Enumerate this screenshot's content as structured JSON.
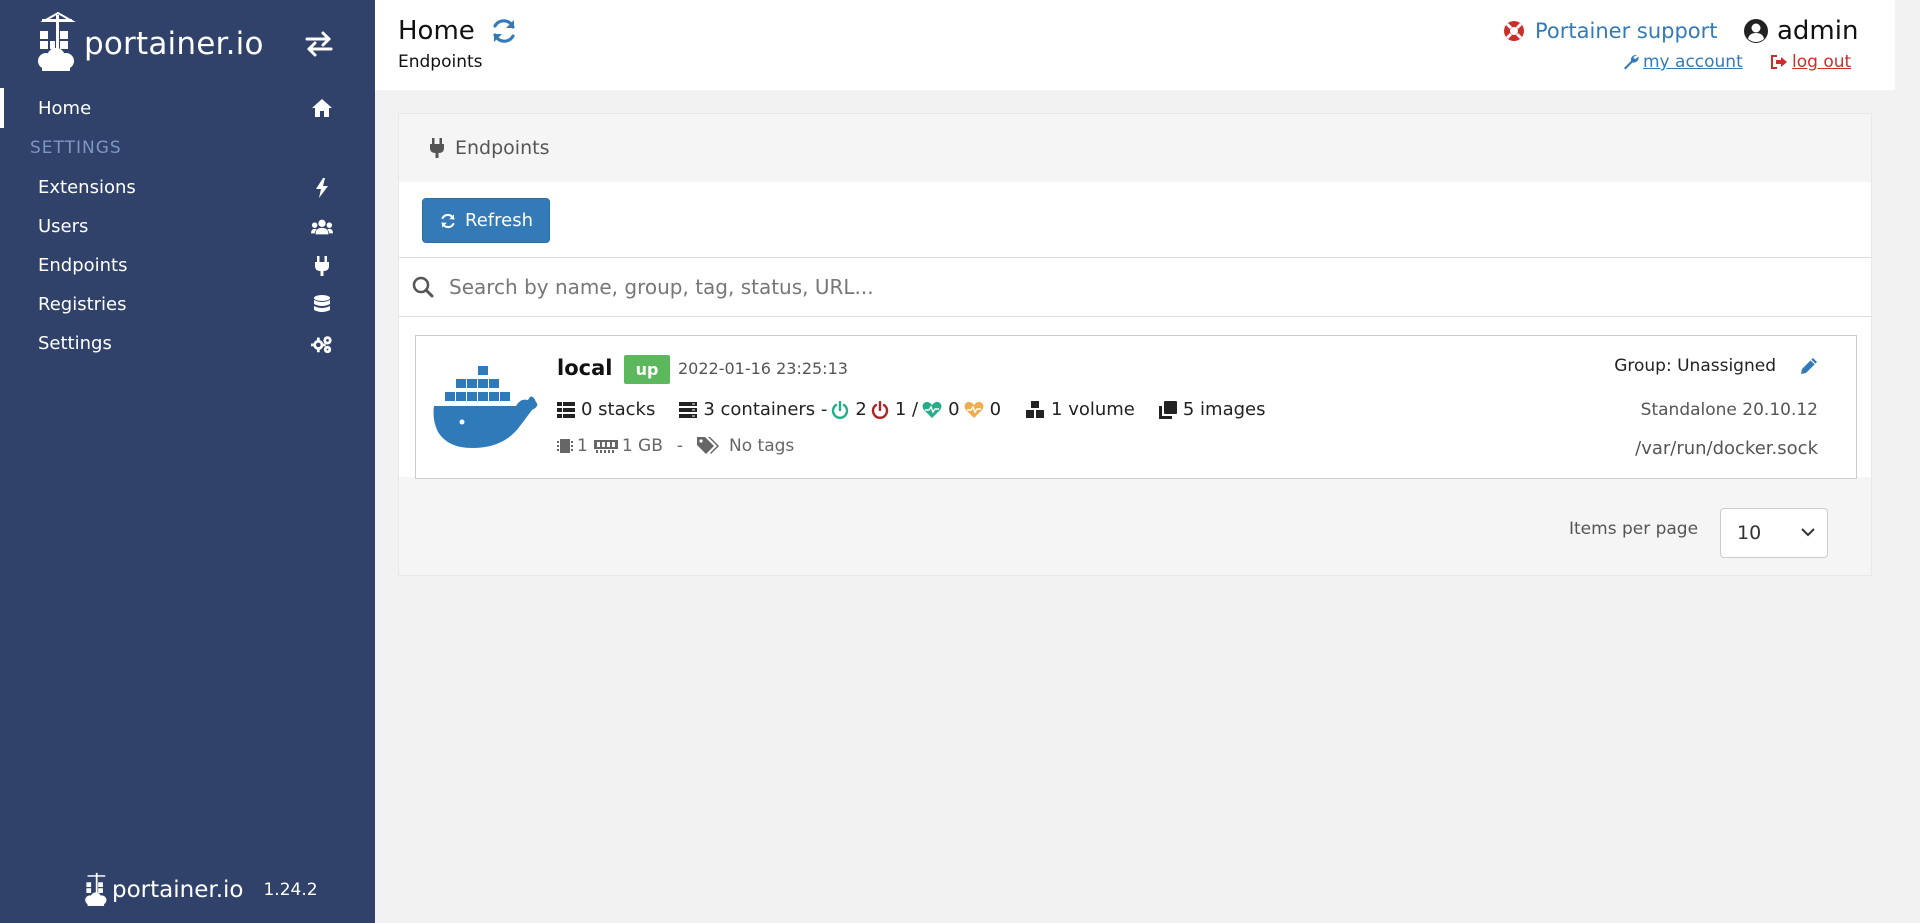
{
  "sidebar": {
    "brand": "portainer.io",
    "items": [
      {
        "label": "Home",
        "icon": "home-icon",
        "active": true
      },
      {
        "label": "Extensions",
        "icon": "bolt-icon"
      },
      {
        "label": "Users",
        "icon": "users-icon"
      },
      {
        "label": "Endpoints",
        "icon": "plug-icon"
      },
      {
        "label": "Registries",
        "icon": "database-icon"
      },
      {
        "label": "Settings",
        "icon": "cogs-icon"
      }
    ],
    "section_label": "SETTINGS",
    "footer": {
      "brand": "portainer.io",
      "version": "1.24.2"
    }
  },
  "header": {
    "title": "Home",
    "breadcrumb": "Endpoints",
    "support": "Portainer support",
    "user": "admin",
    "my_account": "my account",
    "log_out": "log out"
  },
  "widget": {
    "title": "Endpoints",
    "refresh_label": "Refresh",
    "search_placeholder": "Search by name, group, tag, status, URL..."
  },
  "endpoint": {
    "name": "local",
    "status": "up",
    "date": "2022-01-16 23:25:13",
    "stacks": "0 stacks",
    "containers": "3 containers -",
    "running": "2",
    "stopped": "1 /",
    "healthy": "0",
    "unhealthy": "0",
    "volumes": "1 volume",
    "images": "5 images",
    "cpu": "1",
    "memory": "1 GB",
    "separator": "-",
    "tags": "No tags",
    "group": "Group: Unassigned",
    "version": "Standalone 20.10.12",
    "url": "/var/run/docker.sock"
  },
  "pagination": {
    "label": "Items per page",
    "value": "10"
  },
  "colors": {
    "sidebar": "#30426a",
    "primary": "#337ab7",
    "success": "#5cb85c",
    "danger": "#c9302c",
    "running": "#23ae89",
    "stopped": "#ae2323",
    "healthy": "#23ae89",
    "unhealthy": "#f0ad4e",
    "docker": "#2f7ab9"
  }
}
